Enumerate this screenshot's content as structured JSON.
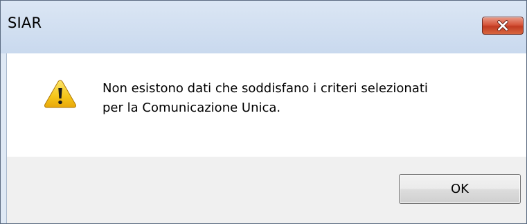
{
  "window": {
    "title": "SIAR"
  },
  "message": {
    "line1": "Non esistono dati che soddisfano i criteri selezionati",
    "line2": "per la Comunicazione Unica."
  },
  "buttons": {
    "ok_label": "OK"
  },
  "icons": {
    "warning": "warning-icon",
    "close": "close-icon"
  },
  "colors": {
    "close_button": "#c94a2f",
    "warning_yellow": "#f5c518",
    "titlebar": "#cfdcef",
    "footer": "#f0f0f0"
  }
}
